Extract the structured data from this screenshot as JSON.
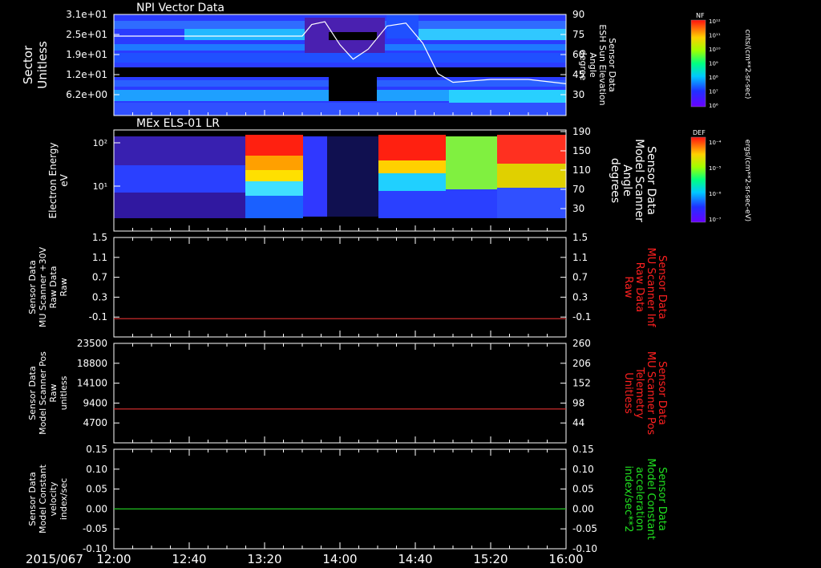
{
  "figure": {
    "date_label": "2015/067",
    "time_ticks": [
      "12:00",
      "12:40",
      "13:20",
      "14:00",
      "14:40",
      "15:20",
      "16:00"
    ]
  },
  "panels": [
    {
      "id": "npi",
      "title": "NPI Vector Data",
      "ylabel_left": [
        "Sector",
        "Unitless"
      ],
      "ylabel_right": [
        "Sensor Data",
        "ESH Sun Elevation",
        "Angle",
        "degree"
      ],
      "yticks_left": [
        "3.1e+01",
        "2.5e+01",
        "1.9e+01",
        "1.2e+01",
        "6.2e+00"
      ],
      "yticks_right": [
        "90",
        "75",
        "60",
        "45",
        "30"
      ],
      "colorbar": {
        "label": "NF",
        "unit": "cnts/(cm**2-sr-sec)",
        "ticks": [
          "10¹²",
          "10¹¹",
          "10¹⁰",
          "10⁹",
          "10⁸",
          "10⁷",
          "10⁶"
        ]
      }
    },
    {
      "id": "els",
      "title": "MEx ELS-01 LR",
      "ylabel_left": [
        "Electron Energy",
        "eV"
      ],
      "ylabel_right": [
        "Sensor Data",
        "Model Scanner",
        "Angle",
        "degrees"
      ],
      "yticks_left": [
        "10²",
        "10¹"
      ],
      "yticks_right": [
        "190",
        "150",
        "110",
        "70",
        "30"
      ],
      "colorbar": {
        "label": "DEF",
        "unit": "ergs/(cm**2-sr-sec-eV)",
        "ticks": [
          "10⁻⁴",
          "10⁻⁵",
          "10⁻⁶",
          "10⁻⁷"
        ]
      }
    },
    {
      "id": "mu_raw",
      "ylabel_left": [
        "Sensor Data",
        "MU Scanner +30V",
        "Raw Data",
        "Raw"
      ],
      "ylabel_right": [
        "Sensor Data",
        "MU Scanner Inf",
        "Raw Data",
        "Raw"
      ],
      "yticks_left": [
        "1.5",
        "1.1",
        "0.7",
        "0.3",
        "-0.1"
      ],
      "yticks_right": [
        "1.5",
        "1.1",
        "0.7",
        "0.3",
        "-0.1"
      ],
      "right_color": "#ff2020",
      "line_color": "#e03030"
    },
    {
      "id": "pos",
      "ylabel_left": [
        "Sensor Data",
        "Model Scanner Pos",
        "Raw",
        "unitless"
      ],
      "ylabel_right": [
        "Sensor Data",
        "MU Scanner Pos",
        "Telemetry",
        "Unitless"
      ],
      "yticks_left": [
        "23500",
        "18800",
        "14100",
        "9400",
        "4700"
      ],
      "yticks_right": [
        "260",
        "206",
        "152",
        "98",
        "44"
      ],
      "right_color": "#ff2020",
      "line_color": "#e03030"
    },
    {
      "id": "vel",
      "ylabel_left": [
        "Sensor Data",
        "Model Constant",
        "velocity",
        "index/sec"
      ],
      "ylabel_right": [
        "Sensor Data",
        "Model Constant",
        "acceleration",
        "index/sec**2"
      ],
      "yticks_left": [
        "0.15",
        "0.10",
        "0.05",
        "0.00",
        "-0.05",
        "-0.10"
      ],
      "yticks_right": [
        "0.15",
        "0.10",
        "0.05",
        "0.00",
        "-0.05",
        "-0.10"
      ],
      "right_color": "#20e020",
      "line_color": "#20c020"
    }
  ],
  "chart_data": [
    {
      "type": "heatmap",
      "title": "NPI Vector Data",
      "xlabel": "",
      "ylabel": "Sector",
      "x_range": [
        "12:00",
        "16:00"
      ],
      "overlay_line": {
        "name": "ESH Sun Elevation Angle",
        "axis": "right",
        "ylim": [
          20,
          90
        ],
        "x": [
          "12:00",
          "13:40",
          "13:45",
          "13:52",
          "14:00",
          "14:07",
          "14:15",
          "14:25",
          "14:35",
          "14:44",
          "14:52",
          "15:00",
          "15:20",
          "15:40",
          "16:00"
        ],
        "y": [
          75,
          75,
          83,
          85,
          69,
          59,
          66,
          82,
          84,
          70,
          49,
          43,
          45,
          45,
          42
        ]
      }
    },
    {
      "type": "heatmap",
      "title": "MEx ELS-01 LR",
      "xlabel": "",
      "ylabel": "Electron Energy",
      "x_range": [
        "12:00",
        "16:00"
      ],
      "overlay_line": {
        "name": "Model Scanner Angle",
        "axis": "right",
        "ylim": [
          10,
          190
        ],
        "x": [
          "12:00",
          "16:00"
        ],
        "y": [
          10,
          10
        ]
      }
    },
    {
      "type": "line",
      "series": [
        {
          "name": "MU Scanner +30V Raw Data",
          "x": [
            "12:00",
            "16:00"
          ],
          "y": [
            -0.01,
            -0.01
          ]
        }
      ],
      "ylim": [
        -0.35,
        1.5
      ]
    },
    {
      "type": "line",
      "series": [
        {
          "name": "Model Scanner Pos",
          "x": [
            "12:00",
            "16:00"
          ],
          "y": [
            8000,
            8000
          ]
        }
      ],
      "ylim": [
        0,
        23500
      ]
    },
    {
      "type": "line",
      "series": [
        {
          "name": "Model Constant velocity",
          "x": [
            "12:00",
            "16:00"
          ],
          "y": [
            0.0,
            0.0
          ]
        }
      ],
      "ylim": [
        -0.1,
        0.15
      ]
    }
  ]
}
